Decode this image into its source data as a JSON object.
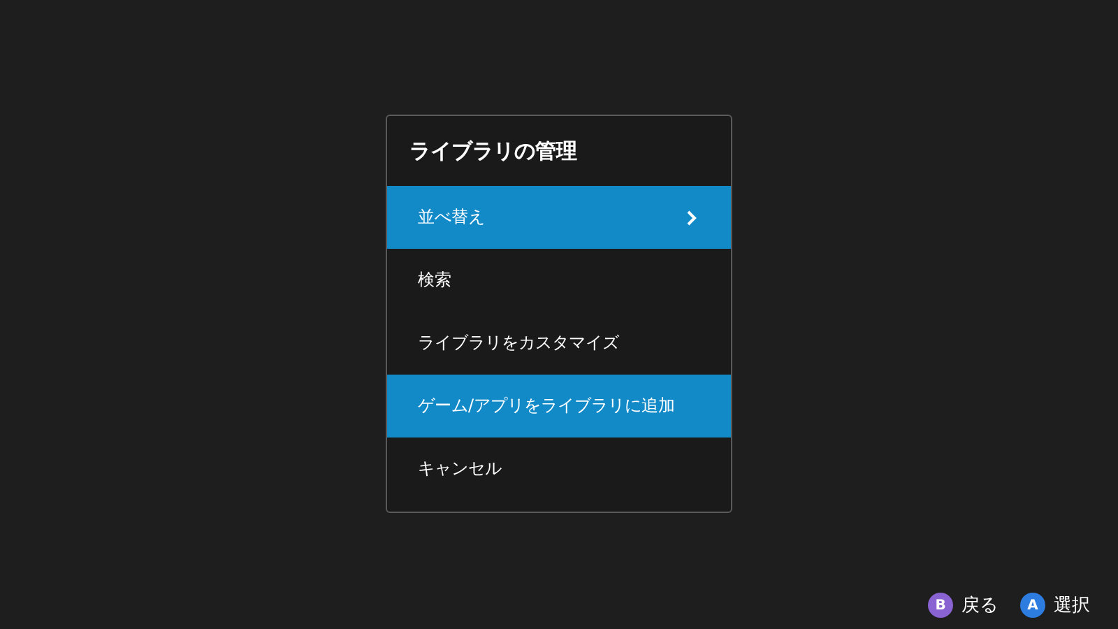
{
  "dialog": {
    "title": "ライブラリの管理",
    "items": [
      {
        "label": "並べ替え",
        "selected": true,
        "has_submenu": true
      },
      {
        "label": "検索",
        "selected": false,
        "has_submenu": false
      },
      {
        "label": "ライブラリをカスタマイズ",
        "selected": false,
        "has_submenu": false
      },
      {
        "label": "ゲーム/アプリをライブラリに追加",
        "selected": true,
        "has_submenu": false
      },
      {
        "label": "キャンセル",
        "selected": false,
        "has_submenu": false
      }
    ]
  },
  "hints": [
    {
      "key": "B",
      "label": "戻る",
      "color": "#8a63d2"
    },
    {
      "key": "A",
      "label": "選択",
      "color": "#2d7de0"
    }
  ]
}
